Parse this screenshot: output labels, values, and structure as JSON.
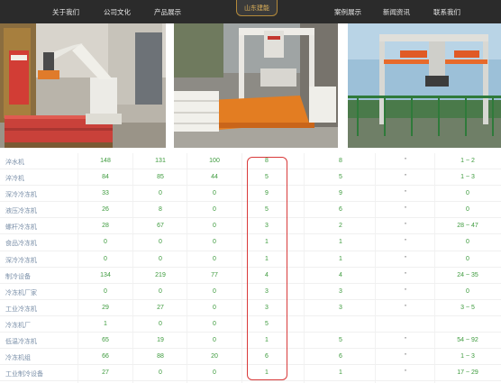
{
  "nav": {
    "items": [
      "关于我们",
      "公司文化",
      "产品展示",
      "案例展示",
      "新闻资讯",
      "联系我们"
    ],
    "logo": "山东建能"
  },
  "photos": [
    "robot-palletizer-photo",
    "gantry-bagging-photo",
    "outdoor-gantry-photo"
  ],
  "table": {
    "rows": [
      {
        "name": "淬水机",
        "v": [
          "148",
          "131",
          "100",
          "8",
          "8",
          "\"",
          "1 ~ 2"
        ]
      },
      {
        "name": "淬冷机",
        "v": [
          "84",
          "85",
          "44",
          "5",
          "5",
          "\"",
          "1 ~ 3"
        ]
      },
      {
        "name": "深冷冷冻机",
        "v": [
          "33",
          "0",
          "0",
          "9",
          "9",
          "\"",
          "0"
        ]
      },
      {
        "name": "液压冷冻机",
        "v": [
          "26",
          "8",
          "0",
          "5",
          "6",
          "\"",
          "0"
        ]
      },
      {
        "name": "螺杆冷冻机",
        "v": [
          "28",
          "67",
          "0",
          "3",
          "2",
          "\"",
          "28 ~ 47"
        ]
      },
      {
        "name": "食品冷冻机",
        "v": [
          "0",
          "0",
          "0",
          "1",
          "1",
          "\"",
          "0"
        ]
      },
      {
        "name": "深冷冷冻机",
        "v": [
          "0",
          "0",
          "0",
          "1",
          "1",
          "\"",
          "0"
        ]
      },
      {
        "name": "制冷设备",
        "v": [
          "134",
          "219",
          "77",
          "4",
          "4",
          "\"",
          "24 ~ 35"
        ]
      },
      {
        "name": "冷冻机厂家",
        "v": [
          "0",
          "0",
          "0",
          "3",
          "3",
          "\"",
          "0"
        ]
      },
      {
        "name": "工业冷冻机",
        "v": [
          "29",
          "27",
          "0",
          "3",
          "3",
          "\"",
          "3 ~ 5"
        ]
      },
      {
        "name": "冷冻机厂",
        "v": [
          "1",
          "0",
          "0",
          "5",
          "",
          "",
          ""
        ]
      },
      {
        "name": "低温冷冻机",
        "v": [
          "65",
          "19",
          "0",
          "1",
          "5",
          "\"",
          "54 ~ 92"
        ]
      },
      {
        "name": "冷冻机组",
        "v": [
          "66",
          "88",
          "20",
          "6",
          "6",
          "\"",
          "1 ~ 3"
        ]
      },
      {
        "name": "工业制冷设备",
        "v": [
          "27",
          "0",
          "0",
          "1",
          "1",
          "\"",
          "17 ~ 29"
        ]
      }
    ]
  },
  "colors": {
    "accent_red": "#d93a3a",
    "value_green": "#3c9a3c",
    "nav_bg": "#2b2b2b"
  }
}
